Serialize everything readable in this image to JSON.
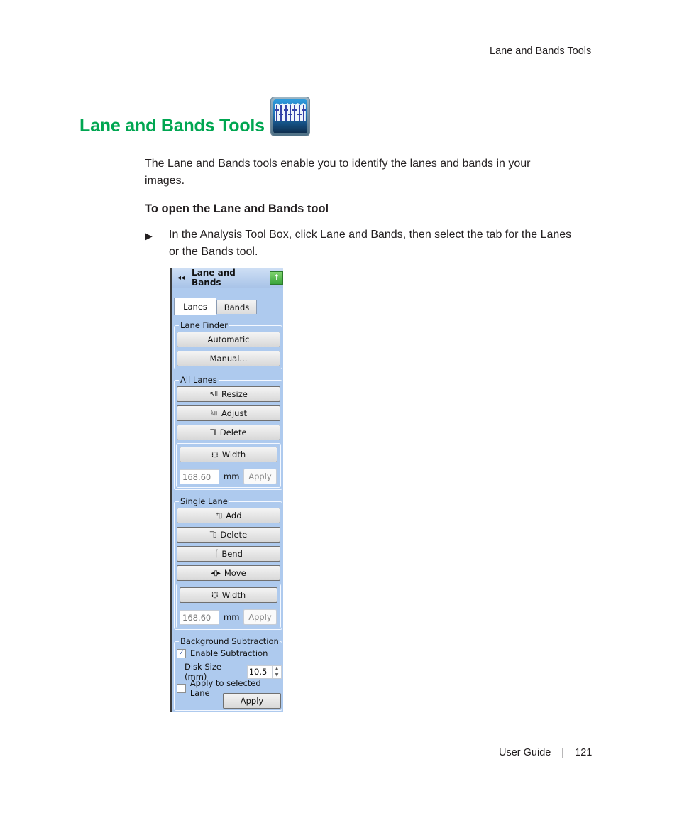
{
  "running_head": "Lane and Bands Tools",
  "title": "Lane and Bands Tools",
  "title_icon": "lane-and-bands-tool-icon",
  "intro": "The Lane and Bands tools enable you to identify the lanes and bands in your images.",
  "procedure_heading": "To open the Lane and Bands tool",
  "step": {
    "marker": "▶",
    "text": "In the Analysis Tool Box, click Lane and Bands, then select the tab for the Lanes or the Bands tool."
  },
  "panel": {
    "header": {
      "collapse_icon": "◂◂",
      "title": "Lane and Bands",
      "up_icon": "↑"
    },
    "tabs": [
      {
        "label": "Lanes",
        "active": true
      },
      {
        "label": "Bands",
        "active": false
      }
    ],
    "lane_finder": {
      "label": "Lane Finder",
      "automatic": "Automatic",
      "manual": "Manual..."
    },
    "all_lanes": {
      "label": "All Lanes",
      "resize": {
        "icon": "↖⦀",
        "label": "Resize"
      },
      "adjust": {
        "icon": "⑊⦀",
        "label": "Adjust"
      },
      "delete": {
        "icon": "‾⦀",
        "label": "Delete"
      },
      "width": {
        "icon": "⁞▯⁞",
        "label": "Width"
      },
      "value": "168.60",
      "unit": "mm",
      "apply": "Apply"
    },
    "single_lane": {
      "label": "Single Lane",
      "add": {
        "icon": "⁺▯",
        "label": "Add"
      },
      "delete": {
        "icon": "‾▯",
        "label": "Delete"
      },
      "bend": {
        "icon": "⌠",
        "label": "Bend"
      },
      "move": {
        "icon": "◂▯▸",
        "label": "Move"
      },
      "width": {
        "icon": "⁞▯⁞",
        "label": "Width"
      },
      "value": "168.60",
      "unit": "mm",
      "apply": "Apply"
    },
    "background_subtraction": {
      "label": "Background Subtraction",
      "enable": {
        "label": "Enable Subtraction",
        "checked": "✓"
      },
      "disk_size_label": "Disk Size (mm)",
      "disk_size_value": "10.5",
      "apply_selected": {
        "label": "Apply to selected Lane",
        "checked": ""
      },
      "apply": "Apply"
    }
  },
  "footer": {
    "label": "User Guide",
    "separator": "|",
    "page": "121"
  }
}
